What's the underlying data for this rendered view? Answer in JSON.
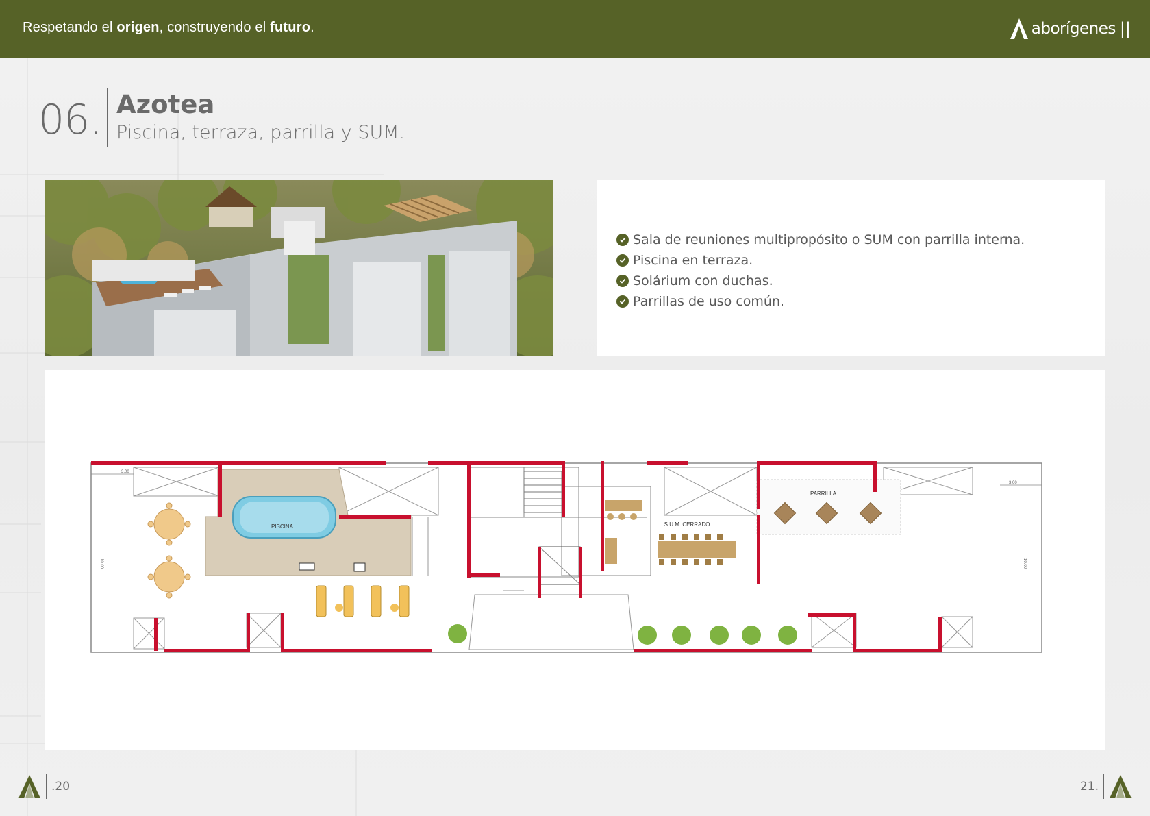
{
  "header": {
    "tagline_pre": "Respetando el ",
    "tagline_b1": "origen",
    "tagline_mid": ", construyendo el ",
    "tagline_b2": "futuro",
    "tagline_end": ".",
    "brand_name": "aborígenes",
    "brand_suffix": "||",
    "brand_color": "#566227"
  },
  "section": {
    "number": "06.",
    "title": "Azotea",
    "subtitle": "Piscina, terraza, parrilla y SUM."
  },
  "features": [
    "Sala de reuniones multipropósito o SUM con parrilla interna.",
    "Piscina en terraza.",
    "Solárium con duchas.",
    "Parrillas de uso común."
  ],
  "plan": {
    "label_pool": "PISCINA",
    "label_sum": "S.U.M. CERRADO",
    "label_grill": "PARRILLA",
    "dim_left": "3.00",
    "dim_right": "3.00",
    "dim_h_left": "10.00",
    "dim_h_right": "10.00",
    "wall_color": "#c8102e"
  },
  "footer": {
    "left_page": ".20",
    "right_page": "21."
  }
}
